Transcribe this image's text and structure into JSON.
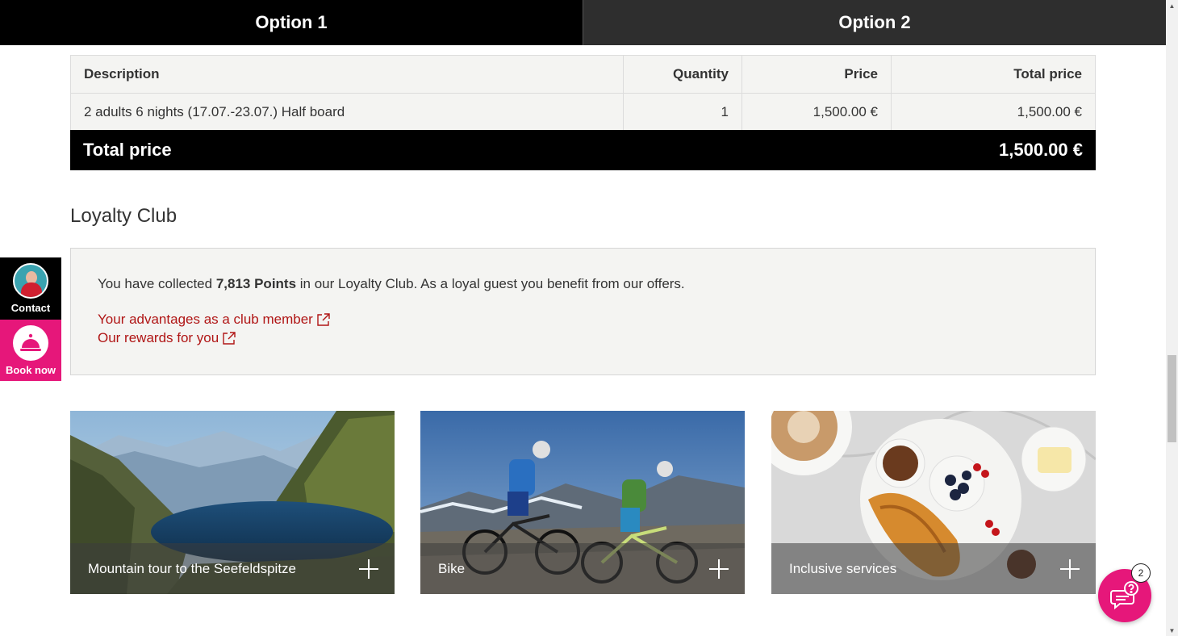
{
  "tabs": [
    {
      "label": "Option 1",
      "active": true
    },
    {
      "label": "Option 2",
      "active": false
    }
  ],
  "price_table": {
    "headers": {
      "description": "Description",
      "quantity": "Quantity",
      "price": "Price",
      "total": "Total price"
    },
    "rows": [
      {
        "description": "2 adults 6 nights (17.07.-23.07.) Half board",
        "quantity": "1",
        "price": "1,500.00 €",
        "total": "1,500.00 €"
      }
    ],
    "total_label": "Total price",
    "total_value": "1,500.00 €"
  },
  "loyalty": {
    "title": "Loyalty Club",
    "text_before": "You have collected ",
    "points": "7,813 Points",
    "text_after": " in our Loyalty Club. As a loyal guest you benefit from our offers.",
    "links": [
      {
        "label": "Your advantages as a club member",
        "icon": "external-link-icon"
      },
      {
        "label": "Our rewards for you",
        "icon": "external-link-icon"
      }
    ]
  },
  "side": {
    "contact_label": "Contact",
    "book_label": "Book now"
  },
  "cards": [
    {
      "label": "Mountain tour to the Seefeldspitze",
      "icon": "plus-icon"
    },
    {
      "label": "Bike",
      "icon": "plus-icon"
    },
    {
      "label": "Inclusive services",
      "icon": "plus-icon"
    }
  ],
  "chat": {
    "badge": "2",
    "icon": "chat-help-icon"
  },
  "colors": {
    "accent_pink": "#e6177a",
    "link_red": "#b01515",
    "dark": "#000000"
  }
}
